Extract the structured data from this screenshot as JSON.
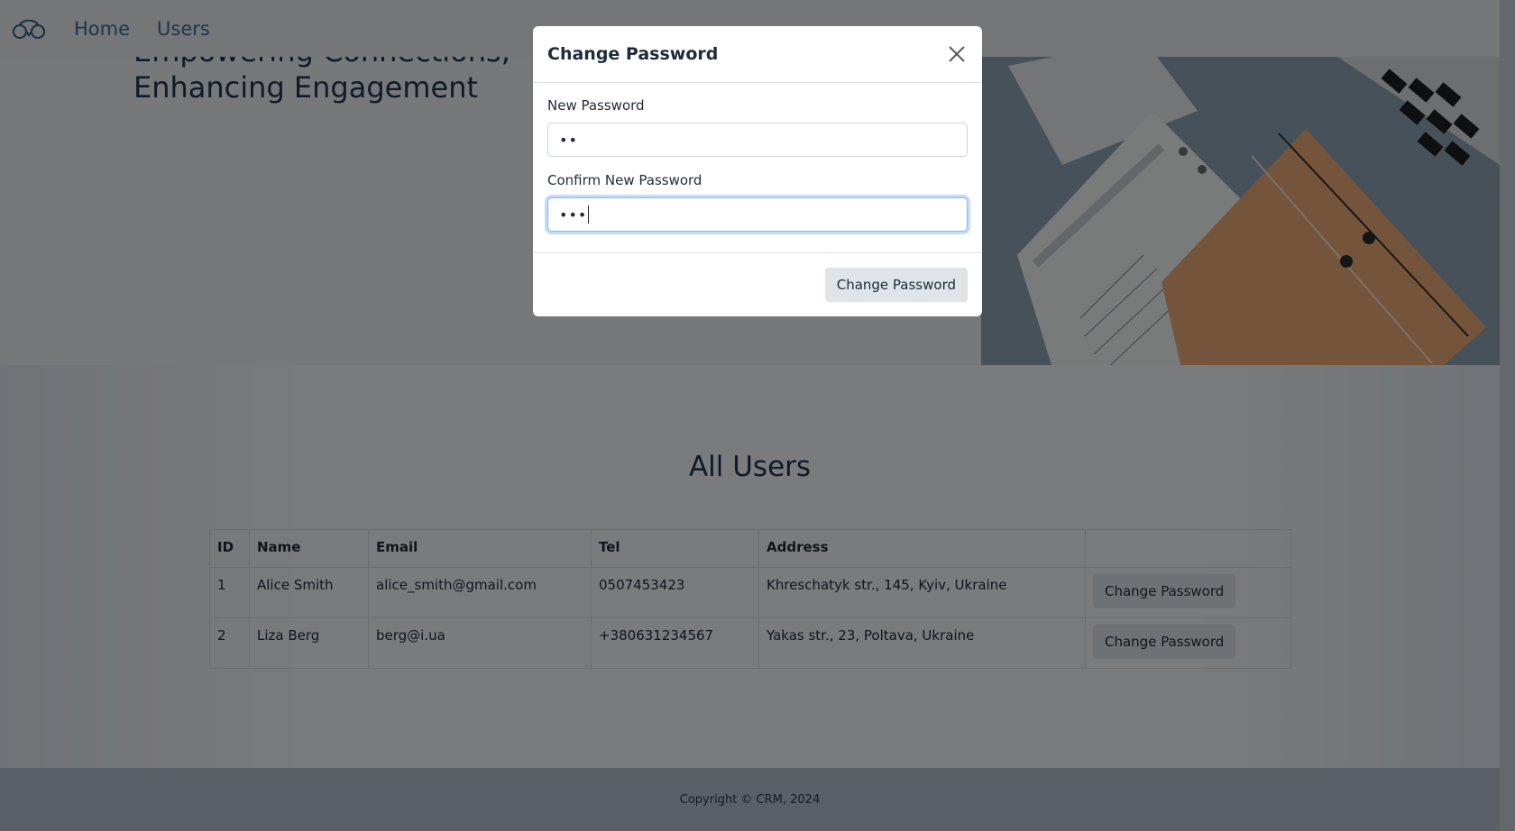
{
  "nav": {
    "links": [
      "Home",
      "Users"
    ]
  },
  "hero": {
    "title_line1": "Empowering Connections,",
    "title_line2": "Enhancing Engagement"
  },
  "users": {
    "heading": "All Users",
    "columns": [
      "ID",
      "Name",
      "Email",
      "Tel",
      "Address",
      ""
    ],
    "rows": [
      {
        "id": "1",
        "name": "Alice Smith",
        "email": "alice_smith@gmail.com",
        "tel": "0507453423",
        "address": "Khreschatyk str., 145, Kyiv, Ukraine",
        "action": "Change Password"
      },
      {
        "id": "2",
        "name": "Liza Berg",
        "email": "berg@i.ua",
        "tel": "+380631234567",
        "address": "Yakas str., 23, Poltava, Ukraine",
        "action": "Change Password"
      }
    ]
  },
  "footer": {
    "copyright": "Copyright © CRM, 2024"
  },
  "modal": {
    "title": "Change Password",
    "new_password_label": "New Password",
    "new_password_value": "••",
    "confirm_password_label": "Confirm New Password",
    "confirm_password_value": "•••",
    "submit_label": "Change Password"
  },
  "colors": {
    "brand": "#3d6a98",
    "heading": "#1e3553",
    "backdrop": "#000000",
    "focus_ring": "#86b7fe"
  }
}
